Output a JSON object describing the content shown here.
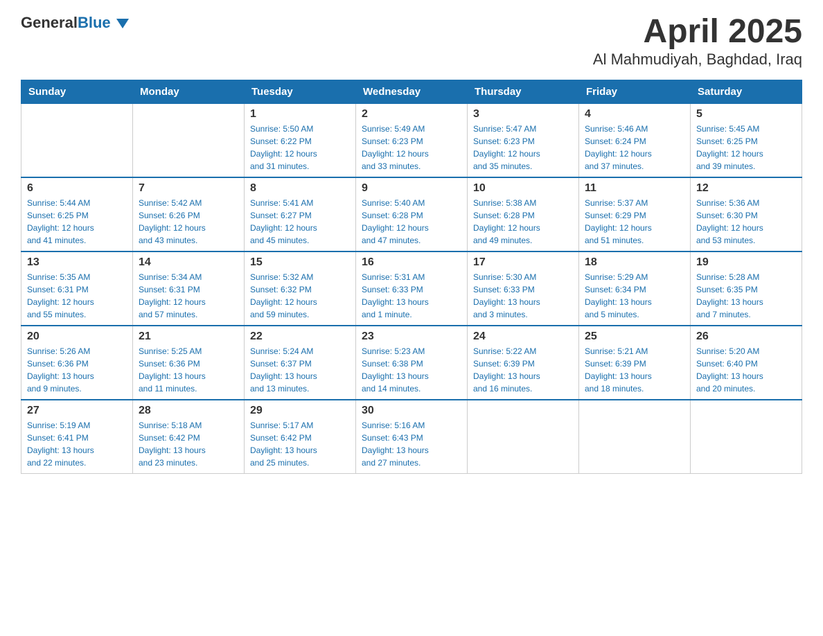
{
  "header": {
    "logo_general": "General",
    "logo_blue": "Blue",
    "title": "April 2025",
    "subtitle": "Al Mahmudiyah, Baghdad, Iraq"
  },
  "days_of_week": [
    "Sunday",
    "Monday",
    "Tuesday",
    "Wednesday",
    "Thursday",
    "Friday",
    "Saturday"
  ],
  "weeks": [
    [
      {
        "day": "",
        "info": ""
      },
      {
        "day": "",
        "info": ""
      },
      {
        "day": "1",
        "info": "Sunrise: 5:50 AM\nSunset: 6:22 PM\nDaylight: 12 hours\nand 31 minutes."
      },
      {
        "day": "2",
        "info": "Sunrise: 5:49 AM\nSunset: 6:23 PM\nDaylight: 12 hours\nand 33 minutes."
      },
      {
        "day": "3",
        "info": "Sunrise: 5:47 AM\nSunset: 6:23 PM\nDaylight: 12 hours\nand 35 minutes."
      },
      {
        "day": "4",
        "info": "Sunrise: 5:46 AM\nSunset: 6:24 PM\nDaylight: 12 hours\nand 37 minutes."
      },
      {
        "day": "5",
        "info": "Sunrise: 5:45 AM\nSunset: 6:25 PM\nDaylight: 12 hours\nand 39 minutes."
      }
    ],
    [
      {
        "day": "6",
        "info": "Sunrise: 5:44 AM\nSunset: 6:25 PM\nDaylight: 12 hours\nand 41 minutes."
      },
      {
        "day": "7",
        "info": "Sunrise: 5:42 AM\nSunset: 6:26 PM\nDaylight: 12 hours\nand 43 minutes."
      },
      {
        "day": "8",
        "info": "Sunrise: 5:41 AM\nSunset: 6:27 PM\nDaylight: 12 hours\nand 45 minutes."
      },
      {
        "day": "9",
        "info": "Sunrise: 5:40 AM\nSunset: 6:28 PM\nDaylight: 12 hours\nand 47 minutes."
      },
      {
        "day": "10",
        "info": "Sunrise: 5:38 AM\nSunset: 6:28 PM\nDaylight: 12 hours\nand 49 minutes."
      },
      {
        "day": "11",
        "info": "Sunrise: 5:37 AM\nSunset: 6:29 PM\nDaylight: 12 hours\nand 51 minutes."
      },
      {
        "day": "12",
        "info": "Sunrise: 5:36 AM\nSunset: 6:30 PM\nDaylight: 12 hours\nand 53 minutes."
      }
    ],
    [
      {
        "day": "13",
        "info": "Sunrise: 5:35 AM\nSunset: 6:31 PM\nDaylight: 12 hours\nand 55 minutes."
      },
      {
        "day": "14",
        "info": "Sunrise: 5:34 AM\nSunset: 6:31 PM\nDaylight: 12 hours\nand 57 minutes."
      },
      {
        "day": "15",
        "info": "Sunrise: 5:32 AM\nSunset: 6:32 PM\nDaylight: 12 hours\nand 59 minutes."
      },
      {
        "day": "16",
        "info": "Sunrise: 5:31 AM\nSunset: 6:33 PM\nDaylight: 13 hours\nand 1 minute."
      },
      {
        "day": "17",
        "info": "Sunrise: 5:30 AM\nSunset: 6:33 PM\nDaylight: 13 hours\nand 3 minutes."
      },
      {
        "day": "18",
        "info": "Sunrise: 5:29 AM\nSunset: 6:34 PM\nDaylight: 13 hours\nand 5 minutes."
      },
      {
        "day": "19",
        "info": "Sunrise: 5:28 AM\nSunset: 6:35 PM\nDaylight: 13 hours\nand 7 minutes."
      }
    ],
    [
      {
        "day": "20",
        "info": "Sunrise: 5:26 AM\nSunset: 6:36 PM\nDaylight: 13 hours\nand 9 minutes."
      },
      {
        "day": "21",
        "info": "Sunrise: 5:25 AM\nSunset: 6:36 PM\nDaylight: 13 hours\nand 11 minutes."
      },
      {
        "day": "22",
        "info": "Sunrise: 5:24 AM\nSunset: 6:37 PM\nDaylight: 13 hours\nand 13 minutes."
      },
      {
        "day": "23",
        "info": "Sunrise: 5:23 AM\nSunset: 6:38 PM\nDaylight: 13 hours\nand 14 minutes."
      },
      {
        "day": "24",
        "info": "Sunrise: 5:22 AM\nSunset: 6:39 PM\nDaylight: 13 hours\nand 16 minutes."
      },
      {
        "day": "25",
        "info": "Sunrise: 5:21 AM\nSunset: 6:39 PM\nDaylight: 13 hours\nand 18 minutes."
      },
      {
        "day": "26",
        "info": "Sunrise: 5:20 AM\nSunset: 6:40 PM\nDaylight: 13 hours\nand 20 minutes."
      }
    ],
    [
      {
        "day": "27",
        "info": "Sunrise: 5:19 AM\nSunset: 6:41 PM\nDaylight: 13 hours\nand 22 minutes."
      },
      {
        "day": "28",
        "info": "Sunrise: 5:18 AM\nSunset: 6:42 PM\nDaylight: 13 hours\nand 23 minutes."
      },
      {
        "day": "29",
        "info": "Sunrise: 5:17 AM\nSunset: 6:42 PM\nDaylight: 13 hours\nand 25 minutes."
      },
      {
        "day": "30",
        "info": "Sunrise: 5:16 AM\nSunset: 6:43 PM\nDaylight: 13 hours\nand 27 minutes."
      },
      {
        "day": "",
        "info": ""
      },
      {
        "day": "",
        "info": ""
      },
      {
        "day": "",
        "info": ""
      }
    ]
  ]
}
